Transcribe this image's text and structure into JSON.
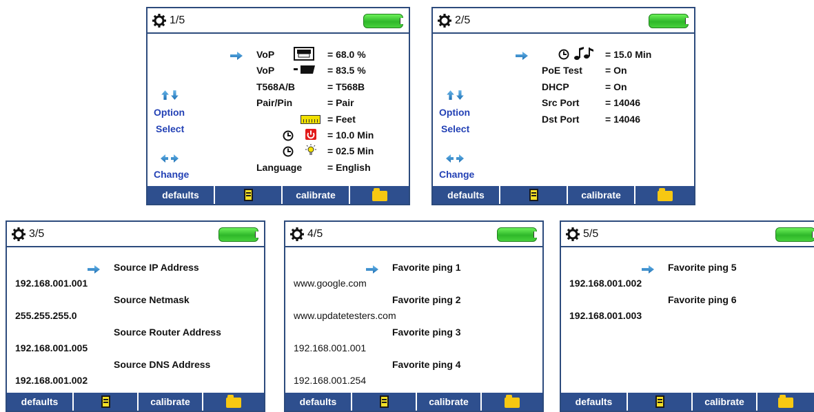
{
  "common": {
    "footer": {
      "defaults": "defaults",
      "calibrate": "calibrate"
    },
    "option": "Option",
    "select": "Select",
    "change": "Change"
  },
  "screen1": {
    "page": "1/5",
    "rows": [
      {
        "label": "VoP",
        "value": "= 68.0 %"
      },
      {
        "label": "VoP",
        "value": "= 83.5 %"
      },
      {
        "label": "T568A/B",
        "value": "= T568B"
      },
      {
        "label": "Pair/Pin",
        "value": "= Pair"
      },
      {
        "label": "",
        "value": "= Feet"
      },
      {
        "label": "",
        "value": "= 10.0 Min"
      },
      {
        "label": "",
        "value": "= 02.5 Min"
      },
      {
        "label": "Language",
        "value": "= English"
      }
    ]
  },
  "screen2": {
    "page": "2/5",
    "rows": [
      {
        "label": "",
        "value": "= 15.0 Min"
      },
      {
        "label": "PoE Test",
        "value": "= On"
      },
      {
        "label": "DHCP",
        "value": "= On"
      },
      {
        "label": "Src Port",
        "value": "= 14046"
      },
      {
        "label": "Dst Port",
        "value": "= 14046"
      }
    ]
  },
  "screen3": {
    "page": "3/5",
    "items": [
      {
        "title": "Source IP Address",
        "value": "192.168.001.001"
      },
      {
        "title": "Source Netmask",
        "value": "255.255.255.0"
      },
      {
        "title": "Source Router Address",
        "value": "192.168.001.005"
      },
      {
        "title": "Source DNS Address",
        "value": "192.168.001.002"
      }
    ]
  },
  "screen4": {
    "page": "4/5",
    "items": [
      {
        "title": "Favorite ping 1",
        "value": "www.google.com"
      },
      {
        "title": "Favorite ping 2",
        "value": "www.updatetesters.com"
      },
      {
        "title": "Favorite ping 3",
        "value": "192.168.001.001"
      },
      {
        "title": "Favorite ping 4",
        "value": "192.168.001.254"
      }
    ]
  },
  "screen5": {
    "page": "5/5",
    "items": [
      {
        "title": "Favorite ping 5",
        "value": "192.168.001.002"
      },
      {
        "title": "Favorite ping 6",
        "value": "192.168.001.003"
      }
    ]
  },
  "colors": {
    "frame": "#2c4a7c",
    "footer": "#2e4f8e",
    "battery": "#3fd33a",
    "accent_text": "#2341b5",
    "arrow": "#2d8fd1"
  }
}
